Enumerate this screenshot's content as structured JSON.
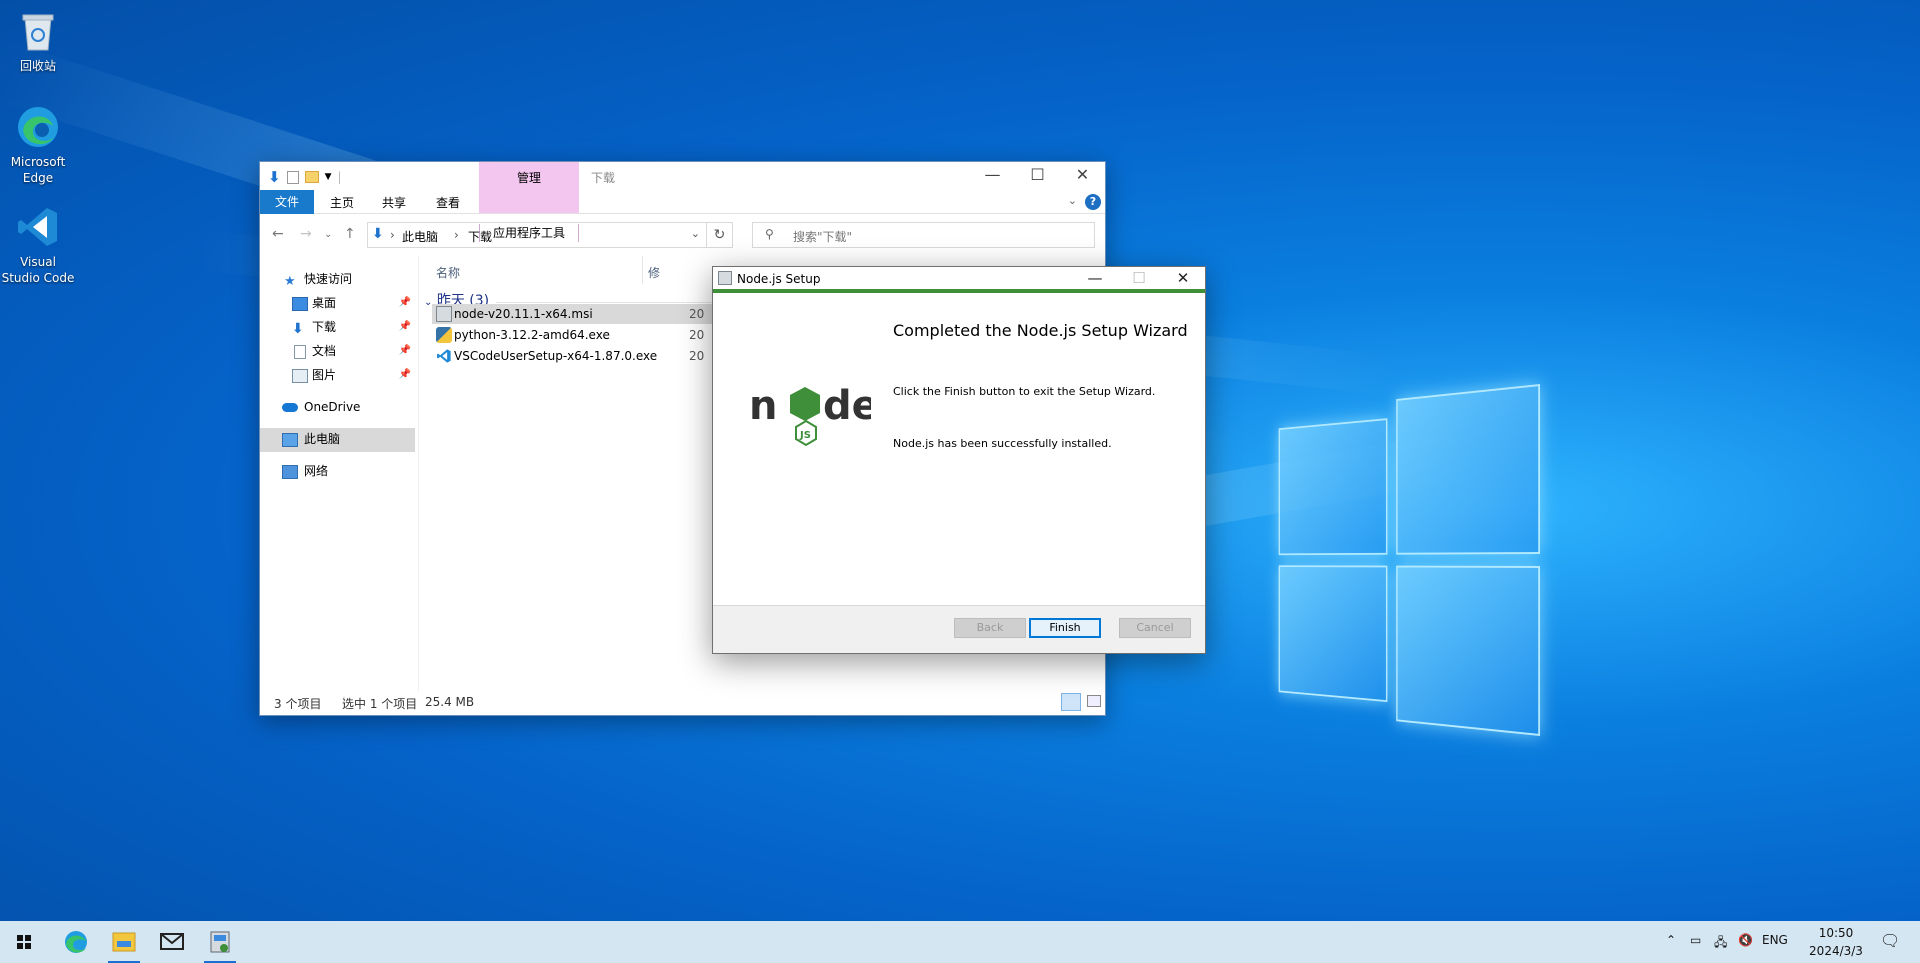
{
  "desktop": {
    "icons": [
      {
        "label": "回收站"
      },
      {
        "label": "Microsoft Edge"
      },
      {
        "label": "Visual Studio Code"
      }
    ]
  },
  "explorer": {
    "title": "下载",
    "ribbon_context": "管理",
    "ribbon_context_sub": "应用程序工具",
    "menu": {
      "file": "文件",
      "home": "主页",
      "share": "共享",
      "view": "查看"
    },
    "breadcrumb": [
      "此电脑",
      "下载"
    ],
    "search_placeholder": "搜索\"下载\"",
    "nav": {
      "quick_access": "快速访问",
      "desktop": "桌面",
      "downloads": "下载",
      "documents": "文档",
      "pictures": "图片",
      "onedrive": "OneDrive",
      "this_pc": "此电脑",
      "network": "网络"
    },
    "columns": {
      "name": "名称",
      "modified": "修"
    },
    "group": "昨天 (3)",
    "files": [
      {
        "name": "node-v20.11.1-x64.msi",
        "date": "20"
      },
      {
        "name": "python-3.12.2-amd64.exe",
        "date": "20"
      },
      {
        "name": "VSCodeUserSetup-x64-1.87.0.exe",
        "date": "20"
      }
    ],
    "status": {
      "count": "3 个项目",
      "selected": "选中 1 个项目",
      "size": "25.4 MB"
    }
  },
  "setup": {
    "title": "Node.js Setup",
    "heading": "Completed the Node.js Setup Wizard",
    "message1": "Click the Finish button to exit the Setup Wizard.",
    "message2": "Node.js has been successfully installed.",
    "buttons": {
      "back": "Back",
      "finish": "Finish",
      "cancel": "Cancel"
    }
  },
  "taskbar": {
    "lang": "ENG",
    "time": "10:50",
    "date": "2024/3/3"
  },
  "colors": {
    "accent": "#1979ca",
    "node_green": "#3e8e3a",
    "node_dark": "#333333"
  }
}
